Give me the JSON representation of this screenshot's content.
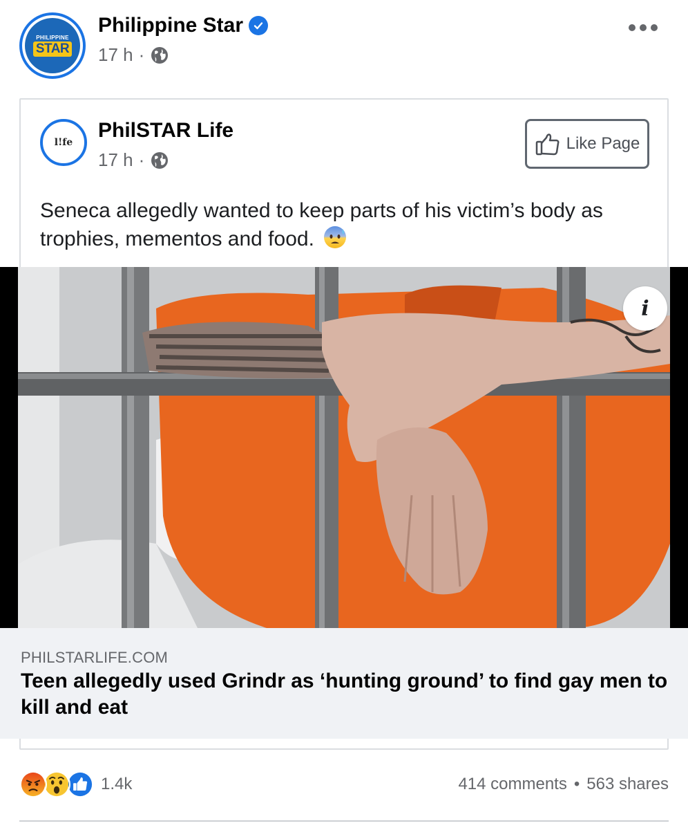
{
  "post": {
    "page_name": "Philippine Star",
    "timestamp": "17 h",
    "separator": "·",
    "verified": true,
    "logo_small_text": "PHILIPPINE",
    "logo_big_text": "STAR"
  },
  "shared": {
    "page_name": "PhilSTAR Life",
    "timestamp": "17 h",
    "separator": "·",
    "logo_text": "l!fe",
    "like_page_label": "Like Page",
    "text": "Seneca allegedly wanted to keep parts of his victim’s body as trophies, mementos and food."
  },
  "link": {
    "info_label": "i",
    "domain": "PHILSTARLIFE.COM",
    "title": "Teen allegedly used Grindr as ‘hunting ground’ to find gay men to kill and eat"
  },
  "stats": {
    "reactions": [
      "angry",
      "wow",
      "like"
    ],
    "reaction_count": "1.4k",
    "comments": "414 comments",
    "dot": "•",
    "shares": "563 shares"
  },
  "colors": {
    "facebook_blue": "#1b74e4",
    "secondary_text": "#65676b",
    "preview_bg": "#f0f2f5",
    "prison_orange": "#e8661f"
  }
}
